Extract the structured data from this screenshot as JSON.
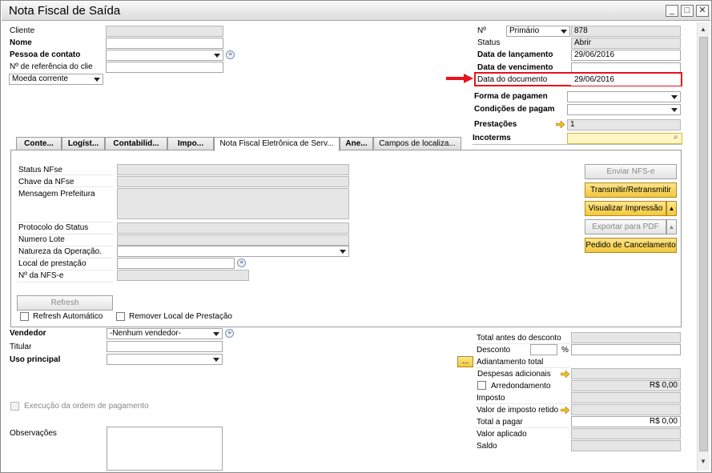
{
  "window": {
    "title": "Nota Fiscal de Saída"
  },
  "header_left": {
    "cliente_label": "Cliente",
    "nome_label": "Nome",
    "pessoa_label": "Pessoa de contato",
    "referencia_label": "Nº de referência do clie",
    "moeda_value": "Moeda corrente"
  },
  "header_right": {
    "numero_label": "Nº",
    "numero_series": "Primário",
    "numero_value": "878",
    "status_label": "Status",
    "status_value": "Abrir",
    "lancamento_label": "Data de lançamento",
    "lancamento_value": "29/06/2016",
    "vencimento_label": "Data de vencimento",
    "vencimento_value": "",
    "documento_label": "Data do documento",
    "documento_value": "29/06/2016",
    "forma_label": "Forma de pagamen",
    "condicoes_label": "Condições de pagam",
    "prestacoes_label": "Prestações",
    "prestacoes_value": "1",
    "incoterms_label": "Incoterms"
  },
  "tabs": [
    {
      "label": "Conte..."
    },
    {
      "label": "Logíst..."
    },
    {
      "label": "Contabilid..."
    },
    {
      "label": "Impo..."
    },
    {
      "label": "Nota Fiscal Eletrônica de Serv..."
    },
    {
      "label": "Ane..."
    },
    {
      "label": "Campos de localiza..."
    }
  ],
  "nfse": {
    "status_label": "Status NFse",
    "chave_label": "Chave da NFse",
    "mensagem_label": "Mensagem Prefeitura",
    "protocolo_label": "Protocolo do Status",
    "lote_label": "Numero Lote",
    "natureza_label": "Natureza da Operação.",
    "local_label": "Local de prestação",
    "numero_label": "Nº da NFS-e",
    "refresh_button": "Refresh",
    "refresh_auto_label": "Refresh Automático",
    "remover_local_label": "Remover Local de Prestação",
    "enviar_button": "Enviar NFS-e",
    "transmitir_button": "Transmitir/Retransmitir",
    "visualizar_button": "Visualizar Impressão",
    "exportar_button": "Exportar para PDF",
    "cancelamento_button": "Pedido de Cancelamento"
  },
  "footer_left": {
    "vendedor_label": "Vendedor",
    "vendedor_value": "-Nenhum vendedor-",
    "titular_label": "Titular",
    "uso_label": "Uso principal",
    "execucao_label": "Execução da ordem de pagamento",
    "observacoes_label": "Observações"
  },
  "totals": {
    "total_antes_label": "Total antes do desconto",
    "desconto_label": "Desconto",
    "desconto_pct": "%",
    "adiantamento_label": "Adiantamento total",
    "adiantamento_btn": "...",
    "despesas_label": "Despesas adicionais",
    "arredondamento_label": "Arredondamento",
    "arredondamento_value": "R$ 0,00",
    "imposto_label": "Imposto",
    "retido_label": "Valor de imposto retido",
    "total_pagar_label": "Total a pagar",
    "total_pagar_value": "R$ 0,00",
    "aplicado_label": "Valor aplicado",
    "saldo_label": "Saldo"
  },
  "colors": {
    "highlight": "#e8121a",
    "yellow_button": "#f2c83c",
    "readonly": "#e6e6e6"
  }
}
